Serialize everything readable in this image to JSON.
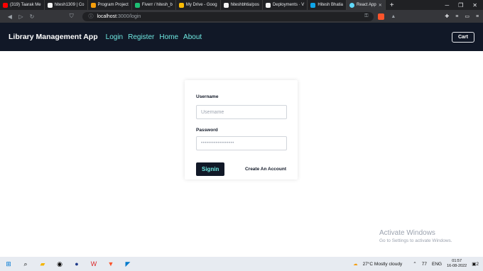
{
  "browser": {
    "tabs": [
      {
        "label": "(319) Taarak Me",
        "color": "#ff0000"
      },
      {
        "label": "hitesh1309 | Co",
        "color": "#f5f5f5"
      },
      {
        "label": "Program Project",
        "color": "#f59e0b"
      },
      {
        "label": "Fiverr / hitesh_b",
        "color": "#1dbf73"
      },
      {
        "label": "My Drive - Goog",
        "color": "#fbbc04"
      },
      {
        "label": "hiteshbhtia/pos",
        "color": "#f5f5f5"
      },
      {
        "label": "Deployments · V",
        "color": "#f5f5f5"
      },
      {
        "label": "Hitesh Bhatia",
        "color": "#0ea5e9"
      },
      {
        "label": "React App",
        "color": "#61dafb"
      }
    ],
    "new_tab": "+",
    "url_host": "localhost",
    "url_path": ":3000/login"
  },
  "navbar": {
    "brand": "Library Management App",
    "links": [
      "Login",
      "Register",
      "Home",
      "About"
    ],
    "cart": "Cart"
  },
  "login": {
    "username_label": "Username",
    "username_placeholder": "Username",
    "password_label": "Password",
    "password_placeholder": "••••••••••••••••••",
    "signin": "Signin",
    "create_account": "Create An Account"
  },
  "watermark": {
    "title": "Activate Windows",
    "subtitle": "Go to Settings to activate Windows."
  },
  "taskbar": {
    "weather": "27°C  Mostly cloudy",
    "count": "77",
    "lang": "ENG",
    "time": "01:57",
    "date": "16-08-2022",
    "notif": "2"
  }
}
